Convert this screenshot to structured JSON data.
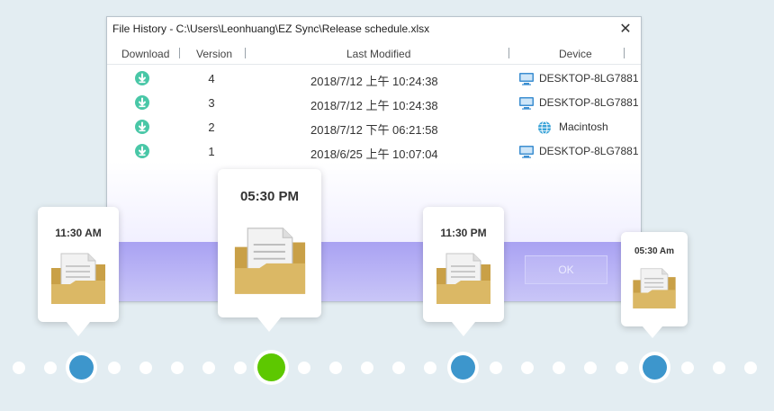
{
  "window": {
    "title": "File History - C:\\Users\\Leonhuang\\EZ Sync\\Release schedule.xlsx",
    "close_glyph": "✕"
  },
  "table": {
    "headers": {
      "download": "Download",
      "version": "Version",
      "modified": "Last Modified",
      "device": "Device"
    },
    "rows": [
      {
        "version": "4",
        "modified": "2018/7/12 上午 10:24:38",
        "device": "DESKTOP-8LG7881",
        "device_icon": "monitor-icon"
      },
      {
        "version": "3",
        "modified": "2018/7/12 上午 10:24:38",
        "device": "DESKTOP-8LG7881",
        "device_icon": "monitor-icon"
      },
      {
        "version": "2",
        "modified": "2018/7/12 下午 06:21:58",
        "device": "Macintosh",
        "device_icon": "globe-icon"
      },
      {
        "version": "1",
        "modified": "2018/6/25 上午 10:07:04",
        "device": "DESKTOP-8LG7881",
        "device_icon": "monitor-icon"
      }
    ]
  },
  "ok_label": "OK",
  "cards": [
    {
      "time": "11:30 AM",
      "icon": "document-folder-icon"
    },
    {
      "time": "05:30 PM",
      "icon": "document-folder-icon"
    },
    {
      "time": "11:30 PM",
      "icon": "document-folder-icon"
    },
    {
      "time": "05:30 Am",
      "icon": "document-folder-icon"
    }
  ],
  "colors": {
    "background": "#e3edf2",
    "download_icon": "#49c7a7",
    "band": "#a9a2f2",
    "timeline_node_blue": "#3d96cc",
    "timeline_node_active": "#5dc800",
    "folder": "#d9b45e"
  }
}
